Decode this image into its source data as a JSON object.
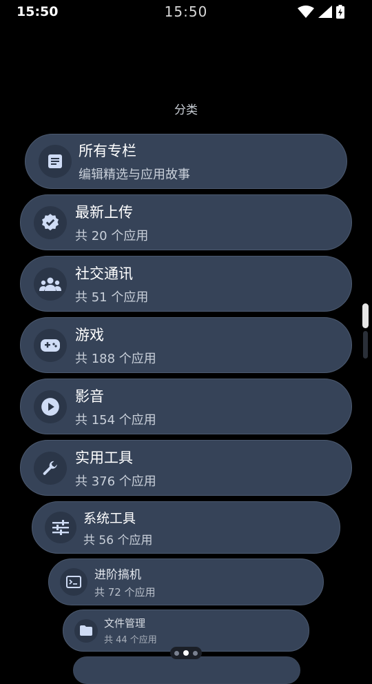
{
  "status_bar": {
    "time_left": "15:50",
    "time_center": "15:50"
  },
  "section_title": "分类",
  "colors": {
    "card_bg": "#364358",
    "icon_fg": "#cfdcf5",
    "icon_bg": "#2b3648"
  },
  "categories": [
    {
      "title": "所有专栏",
      "subtitle": "编辑精选与应用故事",
      "icon": "article-icon"
    },
    {
      "title": "最新上传",
      "subtitle": "共 20 个应用",
      "icon": "verified-badge-icon"
    },
    {
      "title": "社交通讯",
      "subtitle": "共 51 个应用",
      "icon": "group-icon"
    },
    {
      "title": "游戏",
      "subtitle": "共 188 个应用",
      "icon": "gamepad-icon"
    },
    {
      "title": "影音",
      "subtitle": "共 154 个应用",
      "icon": "play-circle-icon"
    },
    {
      "title": "实用工具",
      "subtitle": "共 376 个应用",
      "icon": "wrench-icon"
    },
    {
      "title": "系统工具",
      "subtitle": "共 56 个应用",
      "icon": "tune-icon"
    },
    {
      "title": "进阶搞机",
      "subtitle": "共 72 个应用",
      "icon": "terminal-icon"
    },
    {
      "title": "文件管理",
      "subtitle": "共 44 个应用",
      "icon": "folder-icon"
    }
  ]
}
